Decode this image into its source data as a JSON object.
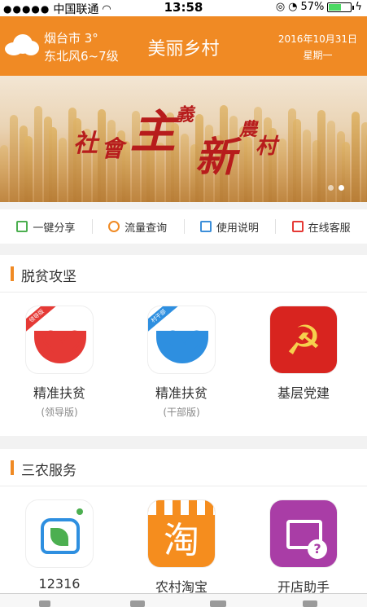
{
  "status_bar": {
    "carrier": "中国联通",
    "time": "13:58",
    "battery": "57%",
    "battery_level": 0.57
  },
  "header": {
    "weather_line1": "烟台市 3°",
    "weather_line2": "东北风6~7级",
    "title": "美丽乡村",
    "date": "2016年10月31日",
    "weekday": "星期一",
    "weather_icon": "cloud-icon"
  },
  "banner": {
    "calligraphy": [
      "社",
      "會",
      "主",
      "義",
      "新",
      "農",
      "村"
    ],
    "active_slide": 1,
    "slide_count": 2
  },
  "quick_actions": [
    {
      "label": "一键分享",
      "icon": "share-icon"
    },
    {
      "label": "流量查询",
      "icon": "data-usage-icon"
    },
    {
      "label": "使用说明",
      "icon": "manual-icon"
    },
    {
      "label": "在线客服",
      "icon": "edit-service-icon"
    }
  ],
  "section_poverty": {
    "title": "脱贫攻坚",
    "items": [
      {
        "label": "精准扶贫",
        "sub": "(领导版)",
        "badge": "领导版"
      },
      {
        "label": "精准扶贫",
        "sub": "(干部版)",
        "badge": "村干部"
      },
      {
        "label": "基层党建"
      }
    ]
  },
  "section_agri": {
    "title": "三农服务",
    "items": [
      {
        "label": "12316"
      },
      {
        "label": "农村淘宝",
        "glyph": "淘"
      },
      {
        "label": "开店助手",
        "glyph": "?"
      }
    ]
  },
  "colors": {
    "accent": "#f08a24",
    "party_red": "#d8241f",
    "blue": "#2e8fe0",
    "purple": "#a93da6"
  }
}
